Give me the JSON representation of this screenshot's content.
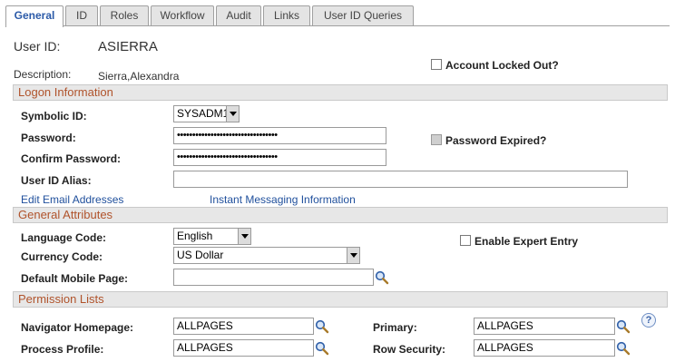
{
  "tabs": [
    {
      "label": "General",
      "active": true
    },
    {
      "label": "ID"
    },
    {
      "label": "Roles"
    },
    {
      "label": "Workflow"
    },
    {
      "label": "Audit"
    },
    {
      "label": "Links"
    },
    {
      "label": "User ID Queries"
    }
  ],
  "header": {
    "user_id_label": "User ID:",
    "user_id_value": "ASIERRA",
    "description_label": "Description:",
    "description_value": "Sierra,Alexandra",
    "account_locked_label": "Account Locked Out?",
    "account_locked_checked": false
  },
  "logon": {
    "section_title": "Logon Information",
    "symbolic_id_label": "Symbolic ID:",
    "symbolic_id_value": "SYSADM1",
    "password_label": "Password:",
    "password_value": "•••••••••••••••••••••••••••••••••",
    "confirm_password_label": "Confirm Password:",
    "confirm_password_value": "•••••••••••••••••••••••••••••••••",
    "password_expired_label": "Password Expired?",
    "password_expired_checked": false,
    "user_id_alias_label": "User ID Alias:",
    "user_id_alias_value": "",
    "edit_email_link": "Edit Email Addresses",
    "instant_messaging_link": "Instant Messaging Information"
  },
  "general_attributes": {
    "section_title": "General Attributes",
    "language_code_label": "Language Code:",
    "language_code_value": "English",
    "enable_expert_label": "Enable Expert Entry",
    "enable_expert_checked": false,
    "currency_code_label": "Currency Code:",
    "currency_code_value": "US Dollar",
    "default_mobile_label": "Default Mobile Page:",
    "default_mobile_value": ""
  },
  "permission_lists": {
    "section_title": "Permission Lists",
    "navigator_homepage_label": "Navigator Homepage:",
    "navigator_homepage_value": "ALLPAGES",
    "primary_label": "Primary:",
    "primary_value": "ALLPAGES",
    "process_profile_label": "Process Profile:",
    "process_profile_value": "ALLPAGES",
    "row_security_label": "Row Security:",
    "row_security_value": "ALLPAGES",
    "help_glyph": "?"
  },
  "colors": {
    "section_text": "#b0532b",
    "link": "#1f4f9c",
    "active_tab_text": "#2b5aa8",
    "section_bg": "#e7e7e7"
  }
}
